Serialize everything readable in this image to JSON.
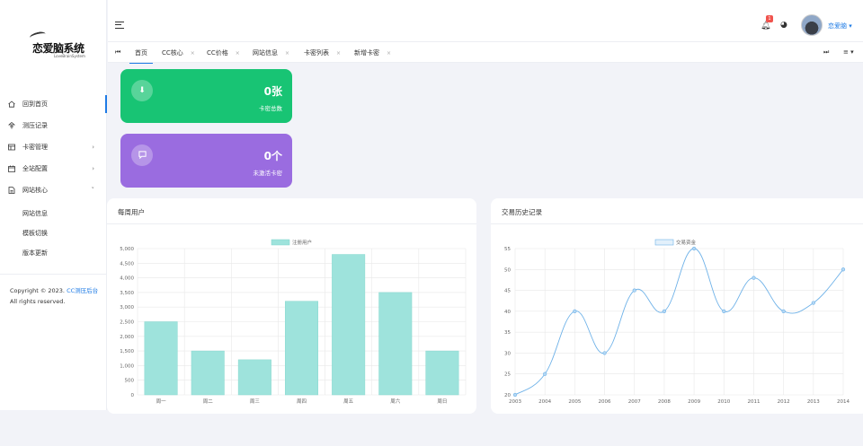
{
  "brand": {
    "logo_text": "恋爱脑系统",
    "logo_sub": "LoveBrainSystem"
  },
  "sidebar": {
    "items": [
      {
        "label": "回到首页",
        "icon": "home-icon",
        "active": true
      },
      {
        "label": "测压记录",
        "icon": "record-icon"
      },
      {
        "label": "卡密管理",
        "icon": "card-icon",
        "arrow": "›"
      },
      {
        "label": "全站配置",
        "icon": "config-icon",
        "arrow": "›"
      },
      {
        "label": "网站核心",
        "icon": "core-icon",
        "arrow": "˅"
      }
    ],
    "sub_items": [
      {
        "label": "网站信息"
      },
      {
        "label": "模板切换"
      },
      {
        "label": "版本更新"
      }
    ],
    "copyright": "Copyright © 2023.",
    "copyright_link": "CC测压后台",
    "rights": "All rights reserved."
  },
  "header": {
    "notification_count": "1",
    "username": "恋爱脑",
    "username_caret": "▾"
  },
  "tabs": [
    {
      "label": "首页",
      "active": true
    },
    {
      "label": "CC核心"
    },
    {
      "label": "CC价格"
    },
    {
      "label": "网站信息"
    },
    {
      "label": "卡密列表"
    },
    {
      "label": "新增卡密"
    }
  ],
  "stats": [
    {
      "value": "0张",
      "label": "卡密总数",
      "color": "#18c474"
    },
    {
      "value": "0个",
      "label": "未激活卡密",
      "color": "#9a6ce0"
    }
  ],
  "cards": {
    "weekly_title": "每周用户",
    "history_title": "交易历史记录"
  },
  "chart_data": [
    {
      "type": "bar",
      "title": "",
      "legend": [
        "注册用户"
      ],
      "legend_position": "top",
      "categories": [
        "周一",
        "周二",
        "周三",
        "周四",
        "周五",
        "周六",
        "周日"
      ],
      "series": [
        {
          "name": "注册用户",
          "values": [
            2500,
            1500,
            1200,
            3200,
            4800,
            3500,
            1500
          ]
        }
      ],
      "ylim": [
        0,
        5000
      ],
      "yticks": [
        "0",
        "500",
        "1,000",
        "1,500",
        "2,000",
        "2,500",
        "3,000",
        "3,500",
        "4,000",
        "4,500",
        "5,000"
      ],
      "grid": true,
      "color": "#9ee3dc"
    },
    {
      "type": "line",
      "title": "",
      "legend": [
        "交易资金"
      ],
      "legend_position": "top",
      "x": [
        "2003",
        "2004",
        "2005",
        "2006",
        "2007",
        "2008",
        "2009",
        "2010",
        "2011",
        "2012",
        "2013",
        "2014"
      ],
      "series": [
        {
          "name": "交易资金",
          "values": [
            20,
            25,
            40,
            30,
            45,
            40,
            55,
            40,
            48,
            40,
            42,
            50
          ]
        }
      ],
      "ylim": [
        20,
        55
      ],
      "yticks": [
        "20",
        "25",
        "30",
        "35",
        "40",
        "45",
        "50",
        "55"
      ],
      "grid": true,
      "color": "#6fb2e8"
    }
  ]
}
